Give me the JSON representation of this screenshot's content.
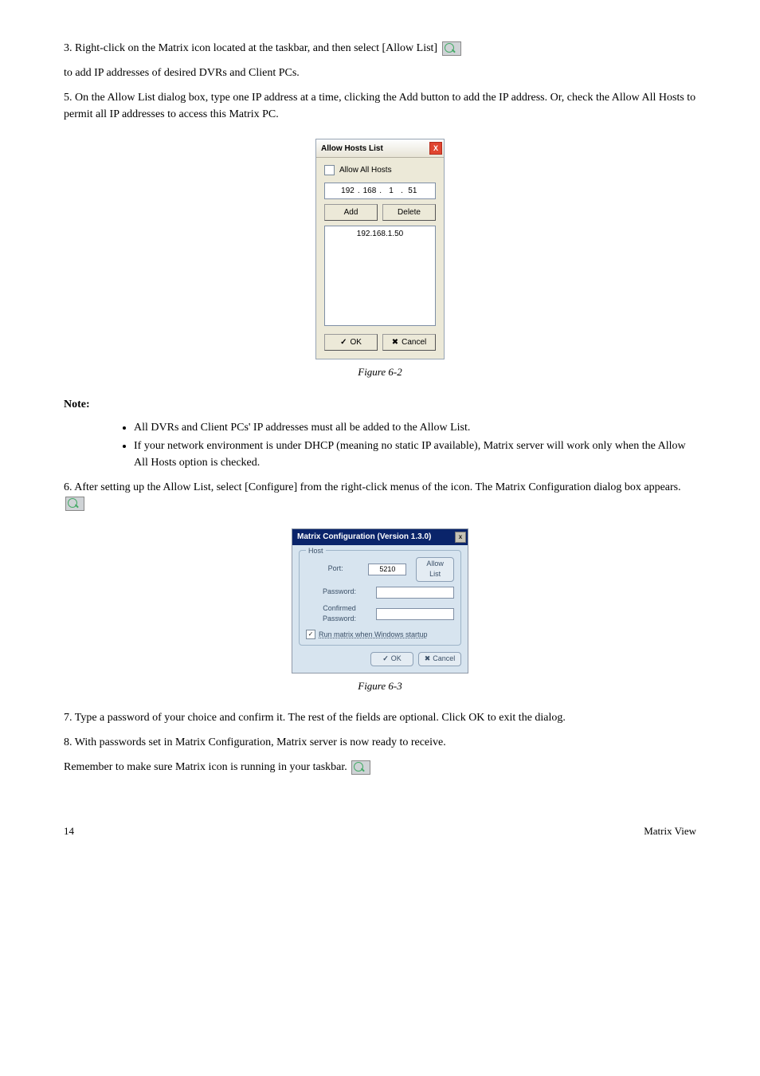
{
  "section1": {
    "heading_text": "to add IP addresses of desired DVRs and Client PCs.",
    "step3": "3. Right-click on the Matrix icon located at the taskbar, and then select [Allow List]",
    "step5": "5. On the Allow List dialog box, type one IP address at a time, clicking the Add button to add the IP address. Or, check the Allow All Hosts to permit all IP addresses to access this Matrix PC."
  },
  "ahl": {
    "title": "Allow Hosts List",
    "allow_all": "Allow All Hosts",
    "ip": {
      "a": "192",
      "b": "168",
      "c": "1",
      "d": "51"
    },
    "add": "Add",
    "delete": "Delete",
    "list_entry": "192.168.1.50",
    "ok": "OK",
    "cancel": "Cancel",
    "caption": "Figure 6-2"
  },
  "notes": {
    "lead_in": "Note:",
    "n1": "All DVRs and Client PCs' IP addresses must all be added to the Allow List.",
    "n2": "If your network environment is under DHCP (meaning no static IP available), Matrix server will work only when the Allow All Hosts option is checked."
  },
  "section2": {
    "step6": "6. After setting up the Allow List, select [Configure] from the right-click menus of the icon. The Matrix Configuration dialog box appears."
  },
  "mc": {
    "title": "Matrix Configuration (Version 1.3.0)",
    "legend": "Host",
    "port_label": "Port:",
    "port_value": "5210",
    "allow_list": "Allow List",
    "password_label": "Password:",
    "confirm_label": "Confirmed Password:",
    "run_startup": "Run matrix when Windows startup",
    "ok": "OK",
    "cancel": "Cancel",
    "caption": "Figure 6-3"
  },
  "section3": {
    "step7": "7. Type a password of your choice and confirm it. The rest of the fields are optional. Click OK to exit the dialog.",
    "step8_a": "8. With passwords set in Matrix Configuration, Matrix server is now ready to receive.",
    "step8_b": "Remember to make sure Matrix icon is running in your taskbar."
  },
  "footer": {
    "left": "14",
    "right": "Matrix View"
  }
}
